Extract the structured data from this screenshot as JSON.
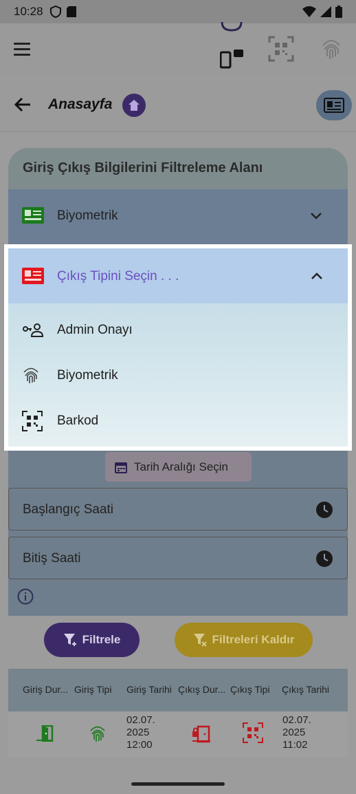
{
  "status_bar": {
    "time": "10:28"
  },
  "nav": {
    "title": "Anasayfa"
  },
  "filter_card": {
    "title": "Giriş Çıkış Bilgilerini Filtreleme Alanı",
    "entry_type_selected": "Biyometrik"
  },
  "dropdown": {
    "placeholder": "Çıkış Tipini Seçin . . .",
    "options": [
      {
        "label": "Admin Onayı",
        "icon": "admin-approval-icon"
      },
      {
        "label": "Biyometrik",
        "icon": "fingerprint-icon"
      },
      {
        "label": "Barkod",
        "icon": "qr-code-icon"
      }
    ]
  },
  "date_range": {
    "label": "Tarih Aralığı Seçin"
  },
  "time_fields": {
    "start_label": "Başlangıç Saati",
    "end_label": "Bitiş Saati"
  },
  "buttons": {
    "filter_label": "Filtrele",
    "clear_label": "Filtreleri Kaldır"
  },
  "table": {
    "headers": [
      "Giriş Dur...",
      "Giriş Tipi",
      "Giriş Tarihi",
      "Çıkış Dur...",
      "Çıkış Tipi",
      "Çıkış Tarihi"
    ],
    "rows": [
      {
        "entry_status_icon": "door-enter-icon",
        "entry_type_icon": "fingerprint-icon",
        "entry_date": [
          "02.07.",
          "2025",
          "12:00"
        ],
        "exit_status_icon": "door-exit-lock-icon",
        "exit_type_icon": "qr-code-icon",
        "exit_date": [
          "02.07.",
          "2025",
          "11:02"
        ]
      }
    ]
  },
  "colors": {
    "primary": "#3c2a68",
    "accent": "#6b4fc2",
    "warning": "#a58a1e",
    "entry_green": "#1f7a1f",
    "exit_red": "#c0181f"
  }
}
